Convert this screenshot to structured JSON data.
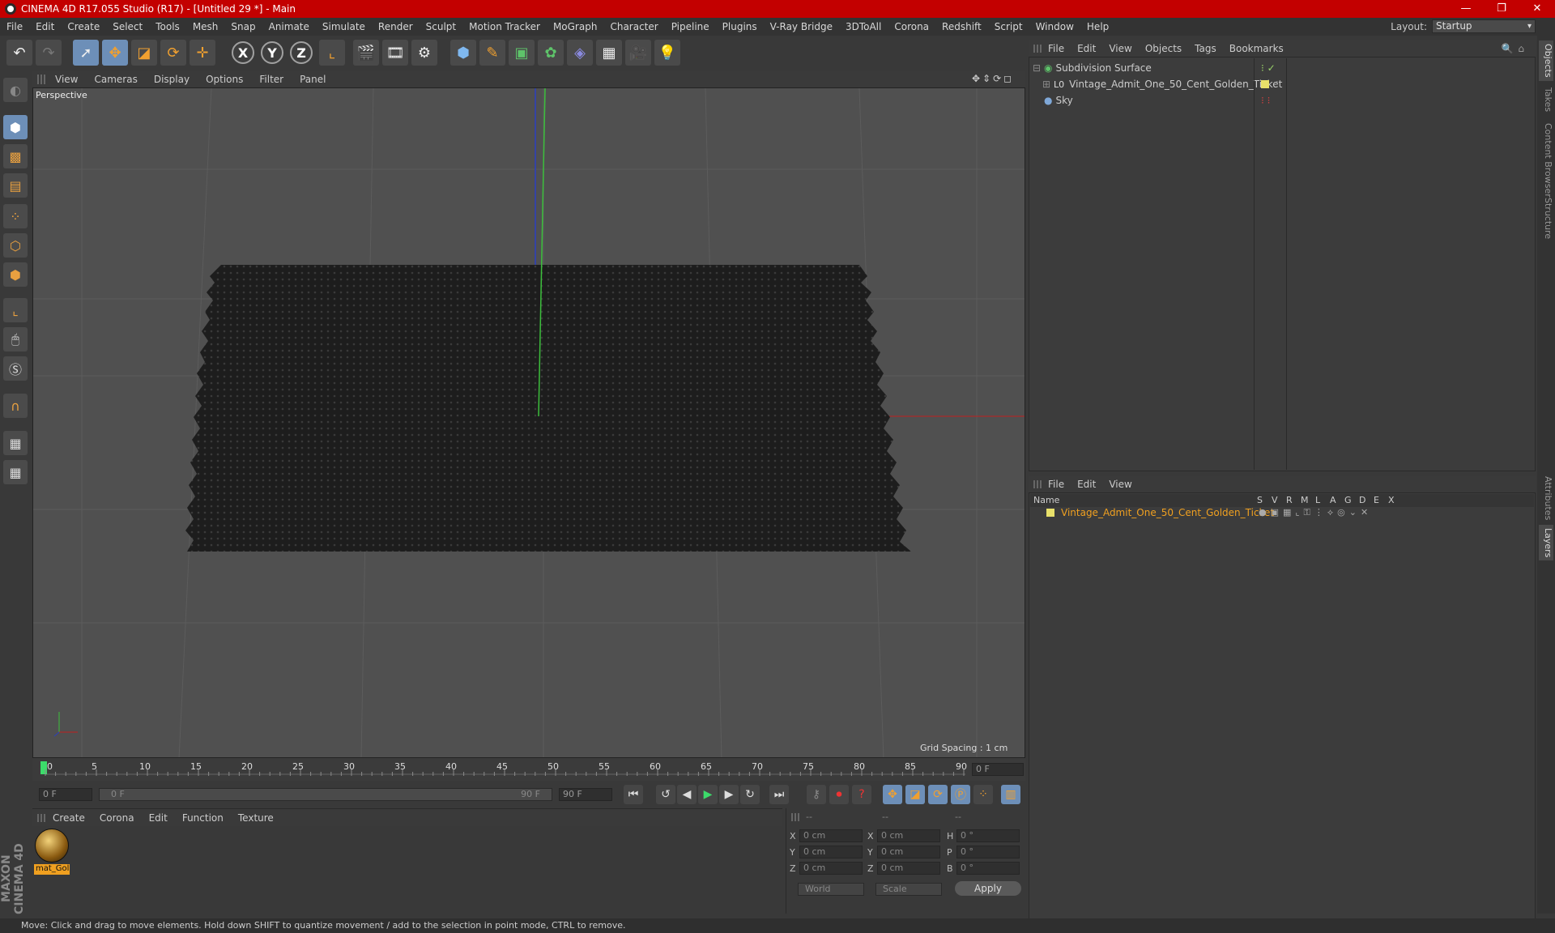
{
  "window": {
    "title": "CINEMA 4D R17.055 Studio (R17) - [Untitled 29 *] - Main",
    "minimize": "—",
    "restore": "❐",
    "close": "✕"
  },
  "menubar": {
    "items": [
      "File",
      "Edit",
      "Create",
      "Select",
      "Tools",
      "Mesh",
      "Snap",
      "Animate",
      "Simulate",
      "Render",
      "Sculpt",
      "Motion Tracker",
      "MoGraph",
      "Character",
      "Pipeline",
      "Plugins",
      "V-Ray Bridge",
      "3DToAll",
      "Corona",
      "Redshift",
      "Script",
      "Window",
      "Help"
    ],
    "layout_label": "Layout:",
    "layout_value": "Startup"
  },
  "viewport": {
    "menu": [
      "View",
      "Cameras",
      "Display",
      "Options",
      "Filter",
      "Panel"
    ],
    "label": "Perspective",
    "grid_spacing": "Grid Spacing : 1 cm",
    "icons": "✥⇕⟳◻"
  },
  "timeline": {
    "ticks": [
      "0",
      "5",
      "10",
      "15",
      "20",
      "25",
      "30",
      "35",
      "40",
      "45",
      "50",
      "55",
      "60",
      "65",
      "70",
      "75",
      "80",
      "85",
      "90"
    ],
    "current_frame": "0 F",
    "start_field": "0 F",
    "range_start": "0 F",
    "range_end": "90 F",
    "end_field": "90 F"
  },
  "material_panel": {
    "menu": [
      "Create",
      "Corona",
      "Edit",
      "Function",
      "Texture"
    ],
    "material_name": "mat_Gol"
  },
  "coordinates": {
    "header": [
      "--",
      "--",
      "--"
    ],
    "rows": [
      {
        "a": "X",
        "av": "0 cm",
        "b": "X",
        "bv": "0 cm",
        "c": "H",
        "cv": "0 °"
      },
      {
        "a": "Y",
        "av": "0 cm",
        "b": "Y",
        "bv": "0 cm",
        "c": "P",
        "cv": "0 °"
      },
      {
        "a": "Z",
        "av": "0 cm",
        "b": "Z",
        "bv": "0 cm",
        "c": "B",
        "cv": "0 °"
      }
    ],
    "space": "World",
    "mode": "Scale",
    "apply": "Apply"
  },
  "objects_panel": {
    "menu": [
      "File",
      "Edit",
      "View",
      "Objects",
      "Tags",
      "Bookmarks"
    ],
    "items": [
      {
        "name": "Subdivision Surface",
        "color": "#5ec36a"
      },
      {
        "name": "Vintage_Admit_One_50_Cent_Golden_Ticket",
        "color": "#c9c9c9"
      },
      {
        "name": "Sky",
        "color": "#7fa8d8"
      }
    ]
  },
  "layers_panel": {
    "menu": [
      "File",
      "Edit",
      "View"
    ],
    "columns": [
      "Name",
      "S",
      "V",
      "R",
      "M",
      "L",
      "A",
      "G",
      "D",
      "E",
      "X"
    ],
    "row": "Vintage_Admit_One_50_Cent_Golden_Ticket"
  },
  "side_tabs": [
    "Objects",
    "Takes",
    "Content Browser",
    "Structure",
    "Attributes",
    "Layers"
  ],
  "status": "Move: Click and drag to move elements. Hold down SHIFT to quantize movement / add to the selection in point mode, CTRL to remove.",
  "brand": "MAXON CINEMA 4D",
  "colors": {
    "accent": "#6d8fb8",
    "title_bar": "#c30000",
    "selection": "#f0a020"
  }
}
